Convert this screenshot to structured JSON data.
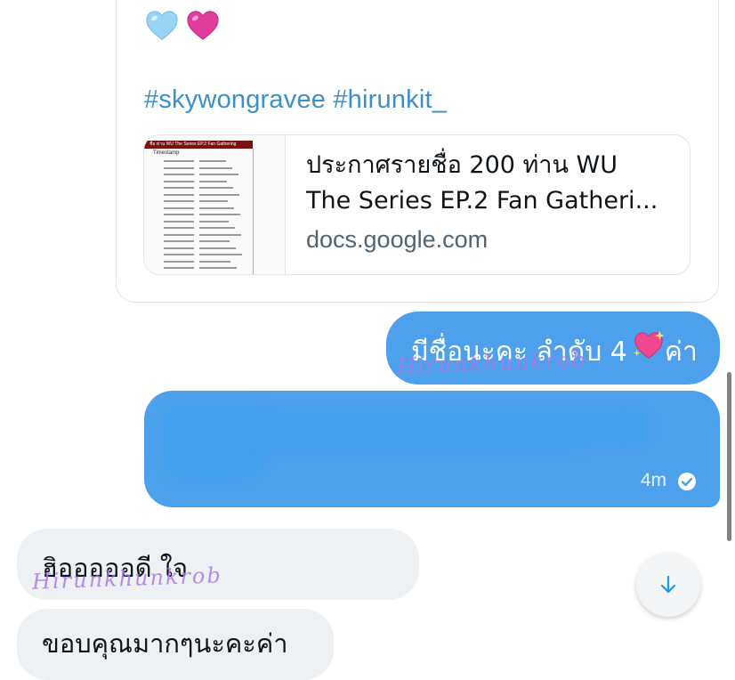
{
  "shared_post": {
    "emojis": [
      "light-blue-heart",
      "pink-heart"
    ],
    "hashtags": "#skywongravee #hirunkit_",
    "link_preview": {
      "title_line1": "ประกาศรายชื่อ 200 ท่าน WU",
      "title_line2": "The Series EP.2 Fan Gatheri...",
      "domain": "docs.google.com",
      "thumbnail": {
        "header": "ชื่อ ท่าน WU The Series EP.2 Fan Gathering",
        "column_header": "Timestamp"
      }
    }
  },
  "messages": {
    "outgoing": [
      {
        "text": "มีชื่อนะคะ ลำดับ 4",
        "suffix": "ค่า",
        "emoji": "sparkling-heart"
      },
      {
        "text": "",
        "time": "4m",
        "status": "seen"
      }
    ],
    "incoming": [
      {
        "text": "ฮิอออออดี ใจ"
      },
      {
        "text": "ขอบคุณมากๆนะคะค่า"
      }
    ]
  },
  "watermark": "Hirunkhunkrob",
  "colors": {
    "outgoing_bubble": "#4da1ec",
    "incoming_bubble": "#eef1f3",
    "hashtag": "#3d8fc7",
    "domain_text": "#536471",
    "watermark": "#aa78e6"
  },
  "icons": {
    "scroll_down": "arrow-down-icon",
    "seen": "check-circle-icon"
  }
}
